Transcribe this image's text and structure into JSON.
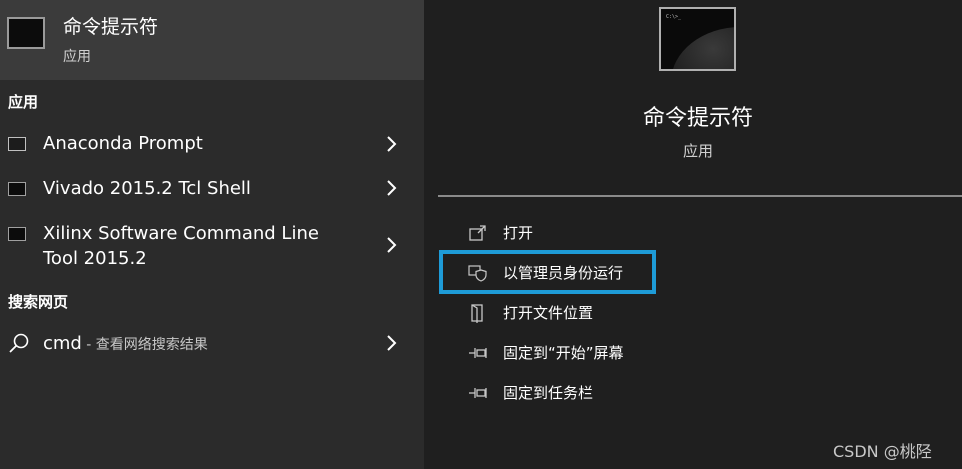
{
  "best_match": {
    "title": "命令提示符",
    "subtitle": "应用",
    "icon": "terminal-icon"
  },
  "apps_section": {
    "header": "应用",
    "items": [
      {
        "label": "Anaconda Prompt",
        "icon": "terminal-icon"
      },
      {
        "label": "Vivado 2015.2 Tcl Shell",
        "icon": "terminal-icon"
      },
      {
        "label_line1": "Xilinx Software Command Line",
        "label_line2": "Tool 2015.2",
        "icon": "terminal-icon"
      }
    ]
  },
  "web_section": {
    "header": "搜索网页",
    "query": "cmd",
    "suffix": " - 查看网络搜索结果",
    "icon": "search-icon"
  },
  "preview": {
    "title": "命令提示符",
    "subtitle": "应用"
  },
  "actions": [
    {
      "label": "打开",
      "icon": "open-icon"
    },
    {
      "label": "以管理员身份运行",
      "icon": "shield-icon"
    },
    {
      "label": "打开文件位置",
      "icon": "folder-icon"
    },
    {
      "label": "固定到“开始”屏幕",
      "icon": "pin-icon"
    },
    {
      "label": "固定到任务栏",
      "icon": "pin-icon"
    }
  ],
  "highlight_color": "#1e9bd7",
  "watermark": "CSDN @桃陉"
}
